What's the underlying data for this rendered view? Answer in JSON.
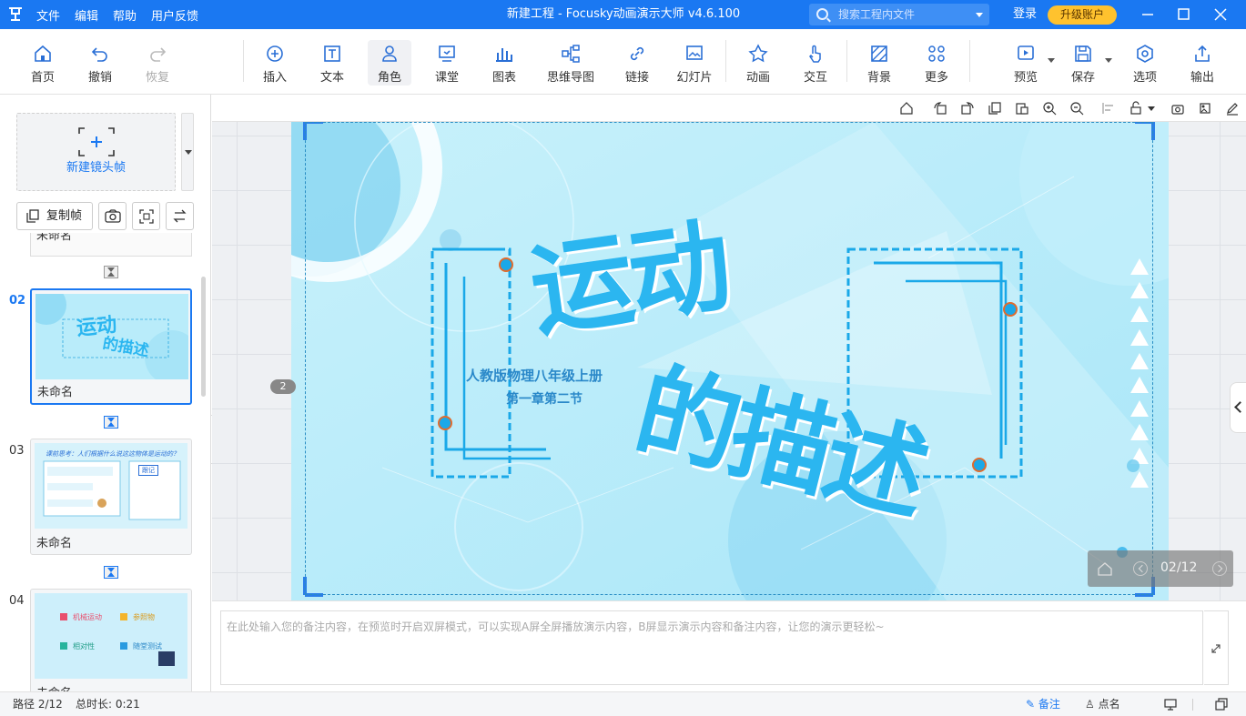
{
  "titlebar": {
    "logo": "Focusky-logo",
    "menu": [
      "文件",
      "编辑",
      "帮助",
      "用户反馈"
    ],
    "title": "新建工程 - Focusky动画演示大师  v4.6.100",
    "search_placeholder": "搜索工程内文件",
    "login": "登录",
    "upgrade": "升级账户"
  },
  "toolbar": {
    "tools": [
      {
        "label": "首页",
        "icon": "home-icon"
      },
      {
        "label": "撤销",
        "icon": "undo-icon"
      },
      {
        "label": "恢复",
        "icon": "redo-icon"
      },
      {
        "label": "插入",
        "icon": "plus-circle-icon"
      },
      {
        "label": "文本",
        "icon": "text-icon"
      },
      {
        "label": "角色",
        "icon": "user-icon"
      },
      {
        "label": "课堂",
        "icon": "classroom-icon"
      },
      {
        "label": "图表",
        "icon": "bar-chart-icon"
      },
      {
        "label": "思维导图",
        "icon": "mindmap-icon"
      },
      {
        "label": "链接",
        "icon": "link-icon"
      },
      {
        "label": "幻灯片",
        "icon": "slides-icon"
      },
      {
        "label": "动画",
        "icon": "star-icon"
      },
      {
        "label": "交互",
        "icon": "hand-pointer-icon"
      },
      {
        "label": "背景",
        "icon": "background-icon"
      },
      {
        "label": "更多",
        "icon": "more-grid-icon"
      },
      {
        "label": "预览",
        "icon": "play-icon"
      },
      {
        "label": "保存",
        "icon": "save-icon"
      },
      {
        "label": "选项",
        "icon": "settings-icon"
      },
      {
        "label": "输出",
        "icon": "export-icon"
      }
    ]
  },
  "sidebar": {
    "new_frame": "新建镜头帧",
    "copy_frame": "复制帧",
    "partial_frame_name": "未命名",
    "frames": [
      {
        "num": "02",
        "name": "未命名"
      },
      {
        "num": "03",
        "name": "未命名"
      },
      {
        "num": "04",
        "name": "未命名"
      }
    ],
    "thumb2": {
      "t1": "运动",
      "t2": "的描述"
    },
    "thumb3": {
      "q": "课前思考：人们根据什么说这这物体是运动的？",
      "tag": "跟记"
    },
    "thumb4": {
      "items": [
        "机械运动",
        "参照物",
        "相对性",
        "随堂测试"
      ]
    }
  },
  "canvas": {
    "frame_badge": "2",
    "title1": "运动",
    "title2": "的描述",
    "sub1": "人教版物理八年级上册",
    "sub2": "第一章第二节",
    "pager": "02/12"
  },
  "notes": {
    "placeholder": "在此处输入您的备注内容，在预览时开启双屏模式，可以实现A屏全屏播放演示内容，B屏显示演示内容和备注内容，让您的演示更轻松~"
  },
  "status": {
    "path": "路径 2/12",
    "duration": "总时长: 0:21",
    "notes": "备注",
    "rollcall": "点名"
  },
  "colors": {
    "accent": "#1a78f2",
    "upgrade": "#ffc22e",
    "slide_bg": "#b9ecfa",
    "title_text": "#2bb6f0"
  }
}
